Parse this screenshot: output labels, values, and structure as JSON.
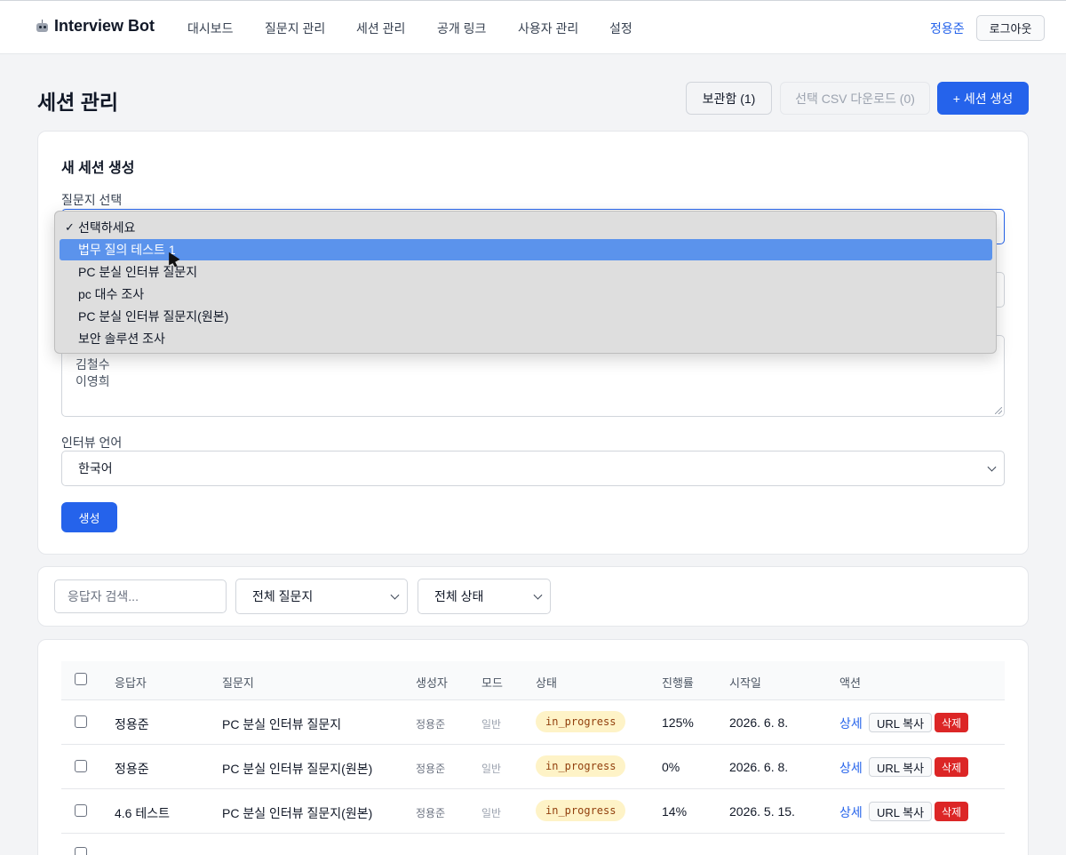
{
  "nav": {
    "brand": "Interview Bot",
    "items": [
      "대시보드",
      "질문지 관리",
      "세션 관리",
      "공개 링크",
      "사용자 관리",
      "설정"
    ],
    "user": "정용준",
    "logout": "로그아웃"
  },
  "header": {
    "title": "세션 관리",
    "archive_label": "보관함 (1)",
    "csv_label": "선택 CSV 다운로드 (0)",
    "create_label": "+ 세션 생성"
  },
  "new_session": {
    "title": "새 세션 생성",
    "questionnaire_label": "질문지 선택",
    "respondents": [
      "김철수",
      "이영희"
    ],
    "language_label": "인터뷰 언어",
    "language_value": "한국어",
    "generate_label": "생성"
  },
  "dropdown": {
    "options": [
      "선택하세요",
      "법무 질의 테스트 1",
      "PC 분실 인터뷰 질문지",
      "pc 대수 조사",
      "PC 분실 인터뷰 질문지(원본)",
      "보안 솔루션 조사"
    ],
    "checked_index": 0,
    "highlighted_index": 1
  },
  "filters": {
    "search_placeholder": "응답자 검색...",
    "questionnaire_filter": "전체 질문지",
    "status_filter": "전체 상태"
  },
  "table": {
    "headers": [
      "응답자",
      "질문지",
      "생성자",
      "모드",
      "상태",
      "진행률",
      "시작일",
      "액션"
    ],
    "rows": [
      {
        "respondent": "정용준",
        "questionnaire": "PC 분실 인터뷰 질문지",
        "creator": "정용준",
        "mode": "일반",
        "status": "in_progress",
        "progress": "125%",
        "started": "2026. 6. 8."
      },
      {
        "respondent": "정용준",
        "questionnaire": "PC 분실 인터뷰 질문지(원본)",
        "creator": "정용준",
        "mode": "일반",
        "status": "in_progress",
        "progress": "0%",
        "started": "2026. 6. 8."
      },
      {
        "respondent": "4.6 테스트",
        "questionnaire": "PC 분실 인터뷰 질문지(원본)",
        "creator": "정용준",
        "mode": "일반",
        "status": "in_progress",
        "progress": "14%",
        "started": "2026. 5. 15."
      }
    ],
    "actions": {
      "detail": "상세",
      "copy_url": "URL 복사",
      "delete": "삭제"
    }
  }
}
